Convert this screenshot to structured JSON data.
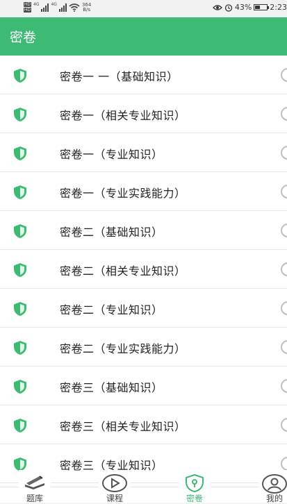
{
  "status_bar": {
    "sim1": "HD",
    "sim2": "HD",
    "net1": "4G",
    "net2": "4G",
    "speed_value": "364",
    "speed_unit": "B/s",
    "battery": "43%",
    "battery_level": 0.43,
    "time": "2:23"
  },
  "header": {
    "title": "密卷"
  },
  "exams": [
    {
      "label": "密卷一 一（基础知识）"
    },
    {
      "label": "密卷一（相关专业知识）"
    },
    {
      "label": "密卷一（专业知识）"
    },
    {
      "label": "密卷一（专业实践能力）"
    },
    {
      "label": "密卷二（基础知识）"
    },
    {
      "label": "密卷二（相关专业知识）"
    },
    {
      "label": "密卷二（专业知识）"
    },
    {
      "label": "密卷二（专业实践能力）"
    },
    {
      "label": "密卷三（基础知识）"
    },
    {
      "label": "密卷三（相关专业知识）"
    },
    {
      "label": "密卷三（专业知识）"
    }
  ],
  "tabbar": {
    "tabs": [
      {
        "label": "题库",
        "icon": "question-bank-icon"
      },
      {
        "label": "课程",
        "icon": "play-icon"
      },
      {
        "label": "密卷",
        "icon": "lock-shield-icon"
      },
      {
        "label": "我的",
        "icon": "user-icon"
      }
    ],
    "active": "密卷"
  },
  "colors": {
    "brand": "#3dbb74",
    "header_text": "#ffffff"
  }
}
